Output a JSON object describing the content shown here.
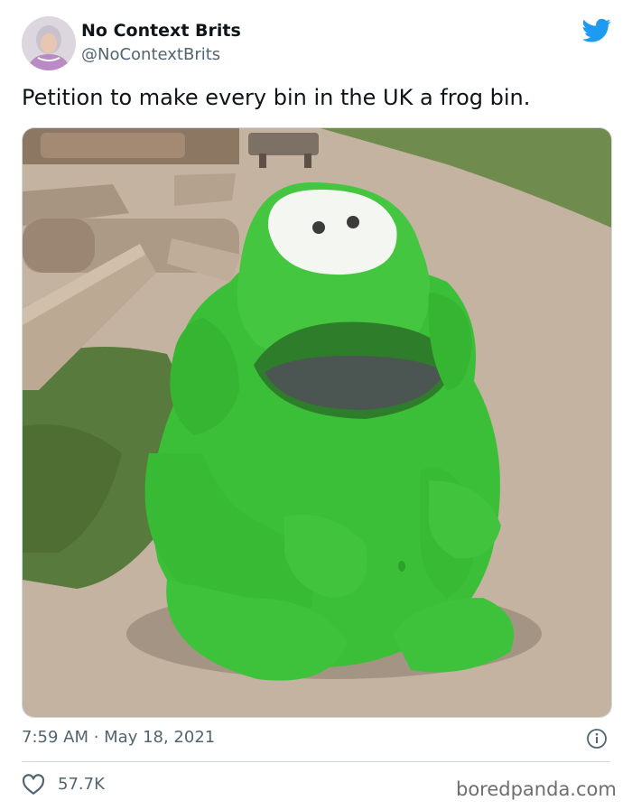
{
  "tweet": {
    "display_name": "No Context Brits",
    "handle": "@NoContextBrits",
    "text": "Petition to make every bin in the UK a frog bin.",
    "timestamp": "7:59 AM · May 18, 2021",
    "likes": "57.7K"
  },
  "icons": {
    "brand": "twitter-bird-icon",
    "info": "info-icon",
    "like": "heart-outline-icon"
  },
  "colors": {
    "twitter_blue": "#1d9bf0",
    "secondary_text": "#536471",
    "frog_green": "#3cc23a"
  },
  "watermark": "boredpanda.com"
}
